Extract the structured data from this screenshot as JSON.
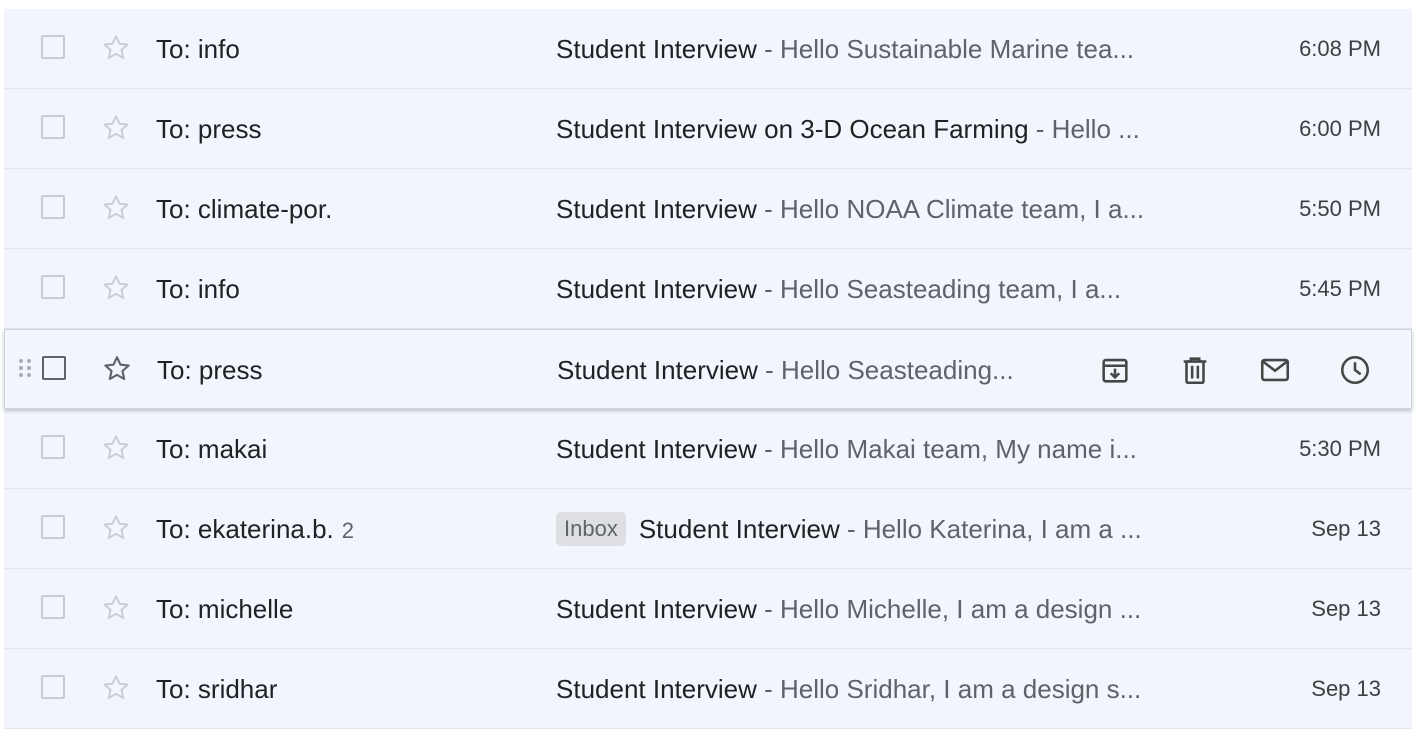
{
  "emails": [
    {
      "sender": "To: info",
      "count": "",
      "label": "",
      "subject": "Student Interview",
      "snippet": " - Hello Sustainable Marine tea...",
      "date": "6:08 PM",
      "hovered": false
    },
    {
      "sender": "To: press",
      "count": "",
      "label": "",
      "subject": "Student Interview on 3-D Ocean Farming",
      "snippet": " - Hello ...",
      "date": "6:00 PM",
      "hovered": false
    },
    {
      "sender": "To: climate-por.",
      "count": "",
      "label": "",
      "subject": "Student Interview",
      "snippet": " - Hello NOAA Climate team, I a...",
      "date": "5:50 PM",
      "hovered": false
    },
    {
      "sender": "To: info",
      "count": "",
      "label": "",
      "subject": "Student Interview",
      "snippet": " - Hello Seasteading team, I a...",
      "date": "5:45 PM",
      "hovered": false
    },
    {
      "sender": "To: press",
      "count": "",
      "label": "",
      "subject": "Student Interview",
      "snippet": " - Hello Seasteading...",
      "date": "",
      "hovered": true
    },
    {
      "sender": "To: makai",
      "count": "",
      "label": "",
      "subject": "Student Interview",
      "snippet": " - Hello Makai team, My name i...",
      "date": "5:30 PM",
      "hovered": false
    },
    {
      "sender": "To: ekaterina.b.",
      "count": "2",
      "label": "Inbox",
      "subject": "Student Interview",
      "snippet": " - Hello Katerina, I am a ...",
      "date": "Sep 13",
      "hovered": false
    },
    {
      "sender": "To: michelle",
      "count": "",
      "label": "",
      "subject": "Student Interview",
      "snippet": " - Hello Michelle, I am a design ...",
      "date": "Sep 13",
      "hovered": false
    },
    {
      "sender": "To: sridhar",
      "count": "",
      "label": "",
      "subject": "Student Interview",
      "snippet": " - Hello Sridhar, I am a design s...",
      "date": "Sep 13",
      "hovered": false
    }
  ],
  "hover_actions": [
    {
      "icon": "archive-icon"
    },
    {
      "icon": "trash-icon"
    },
    {
      "icon": "mark-unread-icon"
    },
    {
      "icon": "snooze-icon"
    }
  ],
  "colors": {
    "row_background": "#f2f6fc",
    "divider": "#e3e7ed",
    "primary_text": "#202124",
    "secondary_text": "#5f6368",
    "label_background": "#dddfe2"
  }
}
